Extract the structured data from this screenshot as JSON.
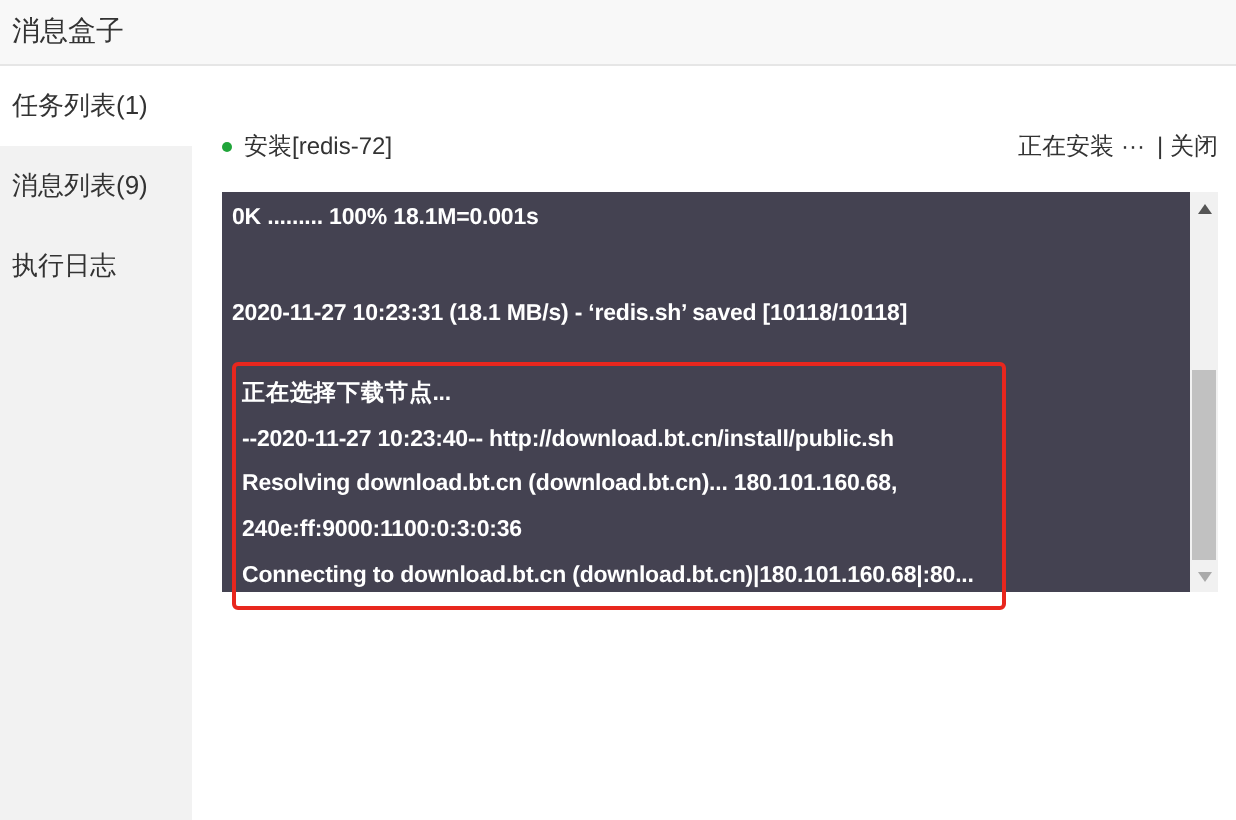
{
  "window": {
    "title": "消息盒子"
  },
  "sidebar": {
    "items": [
      {
        "label": "任务列表(1)",
        "selected": true
      },
      {
        "label": "消息列表(9)",
        "selected": false
      },
      {
        "label": "执行日志",
        "selected": false
      }
    ]
  },
  "task": {
    "name": "安装[redis-72]",
    "color": "#20a53a",
    "progress": "正在安装 ···",
    "close": "| 关闭"
  },
  "log": {
    "blocks": [
      {
        "highlighted": false,
        "lines": [
          "0K ......... 100% 18.1M=0.001s"
        ]
      },
      {
        "highlighted": false,
        "lines": [
          "2020-11-27 10:23:31 (18.1 MB/s) - ‘redis.sh’ saved [10118/10118]"
        ]
      },
      {
        "highlighted": true,
        "lines": [
          "正在选择下载节点...",
          "--2020-11-27 10:23:40-- http://download.bt.cn/install/public.sh",
          "Resolving download.bt.cn (download.bt.cn)... 180.101.160.68,",
          "240e:ff:9000:1100:0:3:0:36",
          "Connecting to download.bt.cn (download.bt.cn)|180.101.160.68|:80..."
        ]
      }
    ]
  }
}
